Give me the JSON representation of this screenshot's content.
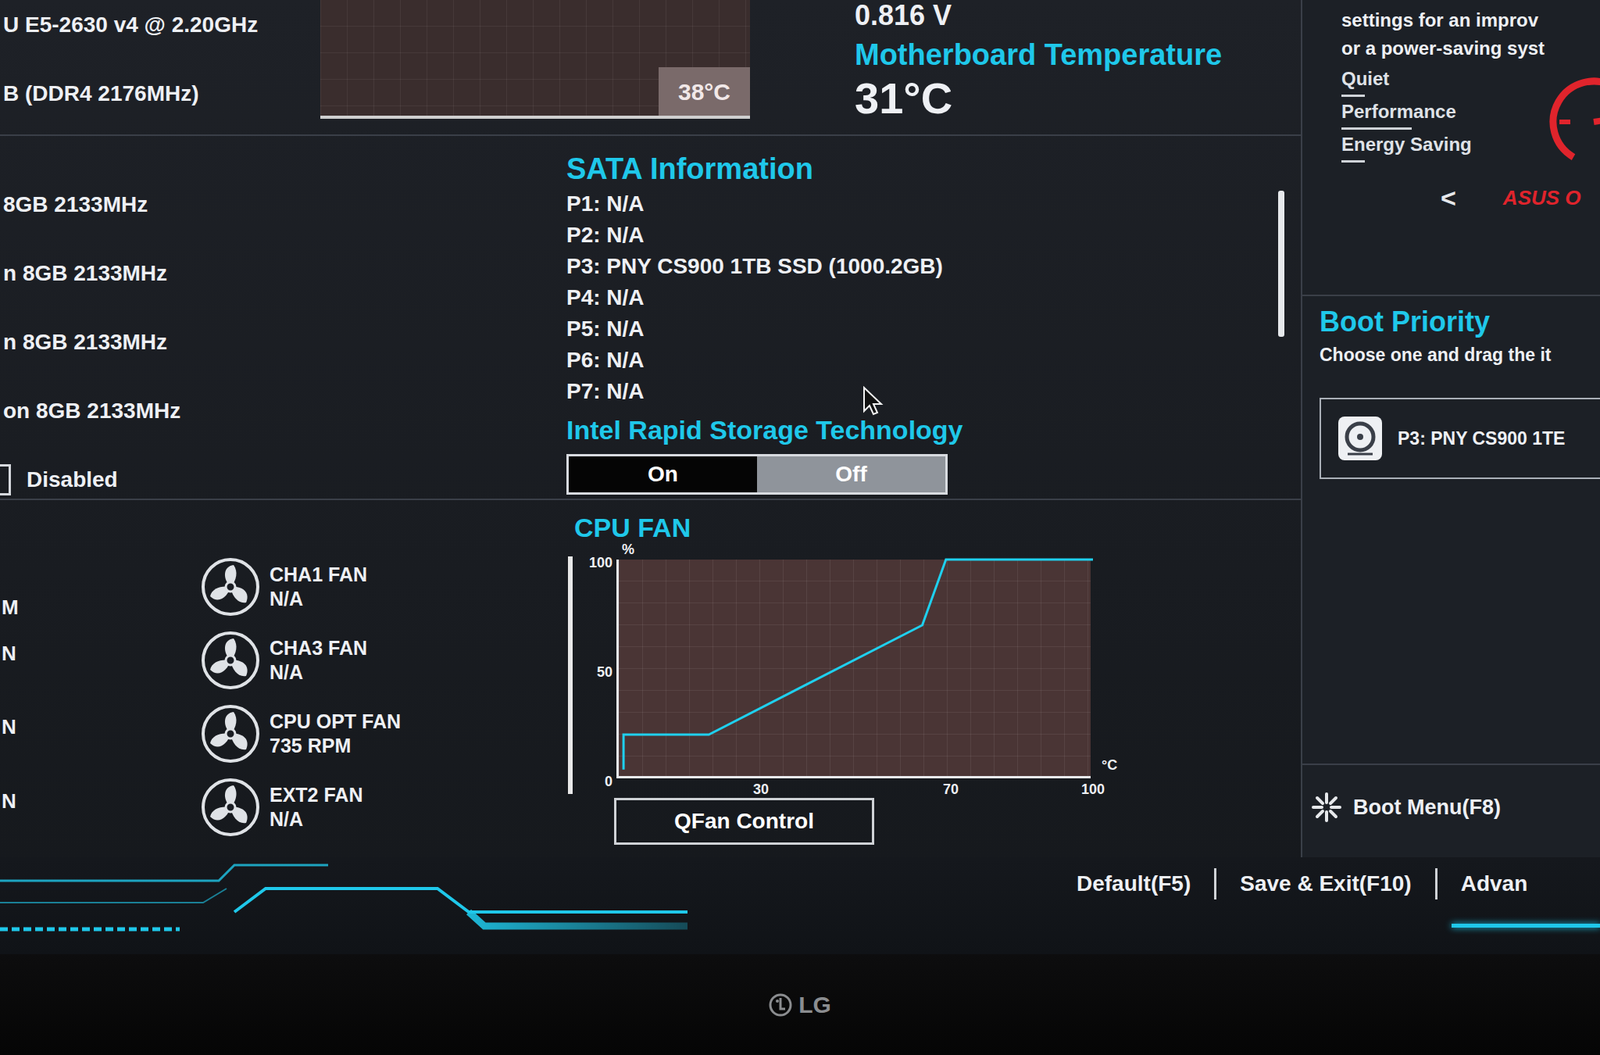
{
  "system": {
    "cpu": "U E5-2630 v4 @ 2.20GHz",
    "memory": "B (DDR4 2176MHz)"
  },
  "cpu_temp_graph": {
    "reading": "38°C"
  },
  "voltage": "0.816 V",
  "mb_temp": {
    "label": "Motherboard Temperature",
    "value": "31°C"
  },
  "ez_tuning": {
    "description": [
      "settings for an improv",
      "or a power-saving syst"
    ],
    "modes": [
      {
        "label": "Quiet",
        "selected": false
      },
      {
        "label": "Performance",
        "selected": true
      },
      {
        "label": "Energy Saving",
        "selected": false
      }
    ],
    "prev": "<",
    "brand": "ASUS O"
  },
  "dram": [
    "8GB 2133MHz",
    "n 8GB 2133MHz",
    "n 8GB 2133MHz",
    "on 8GB 2133MHz"
  ],
  "xmp": {
    "label": "Disabled"
  },
  "sata": {
    "title": "SATA Information",
    "ports": [
      "P1: N/A",
      "P2: N/A",
      "P3: PNY CS900 1TB SSD (1000.2GB)",
      "P4: N/A",
      "P5: N/A",
      "P6: N/A",
      "P7: N/A"
    ]
  },
  "rst": {
    "label": "Intel Rapid Storage Technology",
    "options": [
      {
        "label": "On",
        "selected": false
      },
      {
        "label": "Off",
        "selected": true
      }
    ]
  },
  "fan_fragments": [
    "M",
    "N",
    "N",
    "N"
  ],
  "fans": [
    {
      "name": "CHA1 FAN",
      "reading": "N/A"
    },
    {
      "name": "CHA3 FAN",
      "reading": "N/A"
    },
    {
      "name": "CPU OPT FAN",
      "reading": "735 RPM"
    },
    {
      "name": "EXT2 FAN",
      "reading": "N/A"
    }
  ],
  "fan_chart": {
    "title": "CPU FAN",
    "y_unit": "%",
    "y_ticks": [
      "100",
      "50",
      "0"
    ],
    "x_ticks": [
      "30",
      "70",
      "100"
    ],
    "x_unit": "°C",
    "temps": [
      1,
      1,
      19,
      64,
      69,
      100
    ],
    "percent": [
      4,
      20,
      20,
      70,
      100,
      100
    ]
  },
  "qfan_button": "QFan Control",
  "boot": {
    "title": "Boot Priority",
    "hint": "Choose one and drag the it",
    "items": [
      "P3: PNY CS900 1TE"
    ]
  },
  "boot_menu": "Boot Menu(F8)",
  "footer": [
    "Default(F5)",
    "Save & Exit(F10)",
    "Advan"
  ],
  "bezel": {
    "logo": "LG"
  }
}
